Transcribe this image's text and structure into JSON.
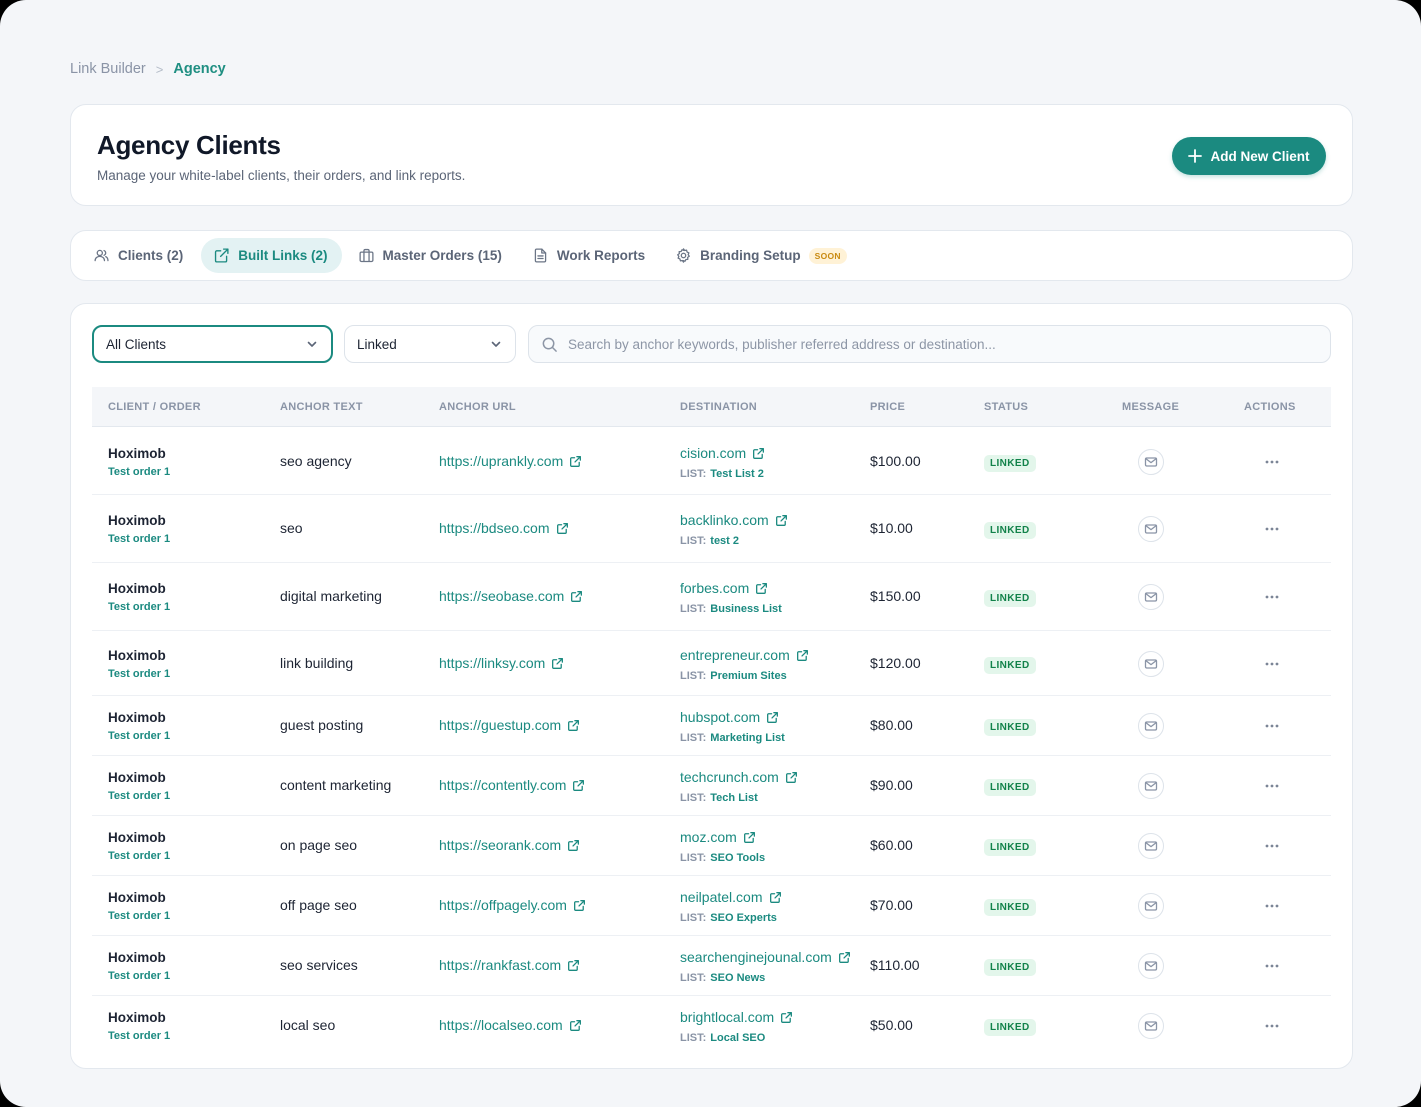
{
  "breadcrumb": {
    "root": "Link Builder",
    "separator": ">",
    "current": "Agency"
  },
  "header": {
    "title": "Agency Clients",
    "subtitle": "Manage your white-label clients, their orders, and link reports.",
    "add_button": "Add New Client"
  },
  "tabs": [
    {
      "label": "Clients (2)",
      "icon": "users-icon"
    },
    {
      "label": "Built Links (2)",
      "icon": "external-link-icon",
      "active": true
    },
    {
      "label": "Master Orders (15)",
      "icon": "briefcase-icon"
    },
    {
      "label": "Work Reports",
      "icon": "document-icon"
    },
    {
      "label": "Branding Setup",
      "icon": "gear-icon",
      "badge": "SOON"
    }
  ],
  "filters": {
    "client_select": "All Clients",
    "status_select": "Linked",
    "search_placeholder": "Search by anchor keywords, publisher referred address or destination..."
  },
  "table": {
    "columns": [
      "CLIENT / ORDER",
      "ANCHOR TEXT",
      "ANCHOR URL",
      "DESTINATION",
      "PRICE",
      "STATUS",
      "MESSAGE",
      "ACTIONS"
    ],
    "list_prefix": "LIST:",
    "rows": [
      {
        "client": "Hoximob",
        "order": "Test order 1",
        "anchor": "seo agency",
        "url": "https://uprankly.com",
        "destination": "cision.com",
        "list": "Test List 2",
        "price": "$100.00",
        "status": "LINKED"
      },
      {
        "client": "Hoximob",
        "order": "Test order 1",
        "anchor": "seo",
        "url": "https://bdseo.com",
        "destination": "backlinko.com",
        "list": "test 2",
        "price": "$10.00",
        "status": "LINKED"
      },
      {
        "client": "Hoximob",
        "order": "Test order 1",
        "anchor": "digital marketing",
        "url": "https://seobase.com",
        "destination": "forbes.com",
        "list": "Business List",
        "price": "$150.00",
        "status": "LINKED"
      },
      {
        "client": "Hoximob",
        "order": "Test order 1",
        "anchor": "link building",
        "url": "https://linksy.com",
        "destination": "entrepreneur.com",
        "list": "Premium Sites",
        "price": "$120.00",
        "status": "LINKED"
      },
      {
        "client": "Hoximob",
        "order": "Test order 1",
        "anchor": "guest posting",
        "url": "https://guestup.com",
        "destination": "hubspot.com",
        "list": "Marketing List",
        "price": "$80.00",
        "status": "LINKED"
      },
      {
        "client": "Hoximob",
        "order": "Test order 1",
        "anchor": "content marketing",
        "url": "https://contently.com",
        "destination": "techcrunch.com",
        "list": "Tech List",
        "price": "$90.00",
        "status": "LINKED"
      },
      {
        "client": "Hoximob",
        "order": "Test order 1",
        "anchor": "on page seo",
        "url": "https://seorank.com",
        "destination": "moz.com",
        "list": "SEO Tools",
        "price": "$60.00",
        "status": "LINKED"
      },
      {
        "client": "Hoximob",
        "order": "Test order 1",
        "anchor": "off page seo",
        "url": "https://offpagely.com",
        "destination": "neilpatel.com",
        "list": "SEO Experts",
        "price": "$70.00",
        "status": "LINKED"
      },
      {
        "client": "Hoximob",
        "order": "Test order 1",
        "anchor": "seo services",
        "url": "https://rankfast.com",
        "destination": "searchenginejounal.com",
        "list": "SEO News",
        "price": "$110.00",
        "status": "LINKED"
      },
      {
        "client": "Hoximob",
        "order": "Test order 1",
        "anchor": "local seo",
        "url": "https://localseo.com",
        "destination": "brightlocal.com",
        "list": "Local SEO",
        "price": "$50.00",
        "status": "LINKED"
      }
    ]
  },
  "colors": {
    "accent": "#1b8a80",
    "status_linked": "#12824a",
    "soon_badge": "#c98a10"
  }
}
